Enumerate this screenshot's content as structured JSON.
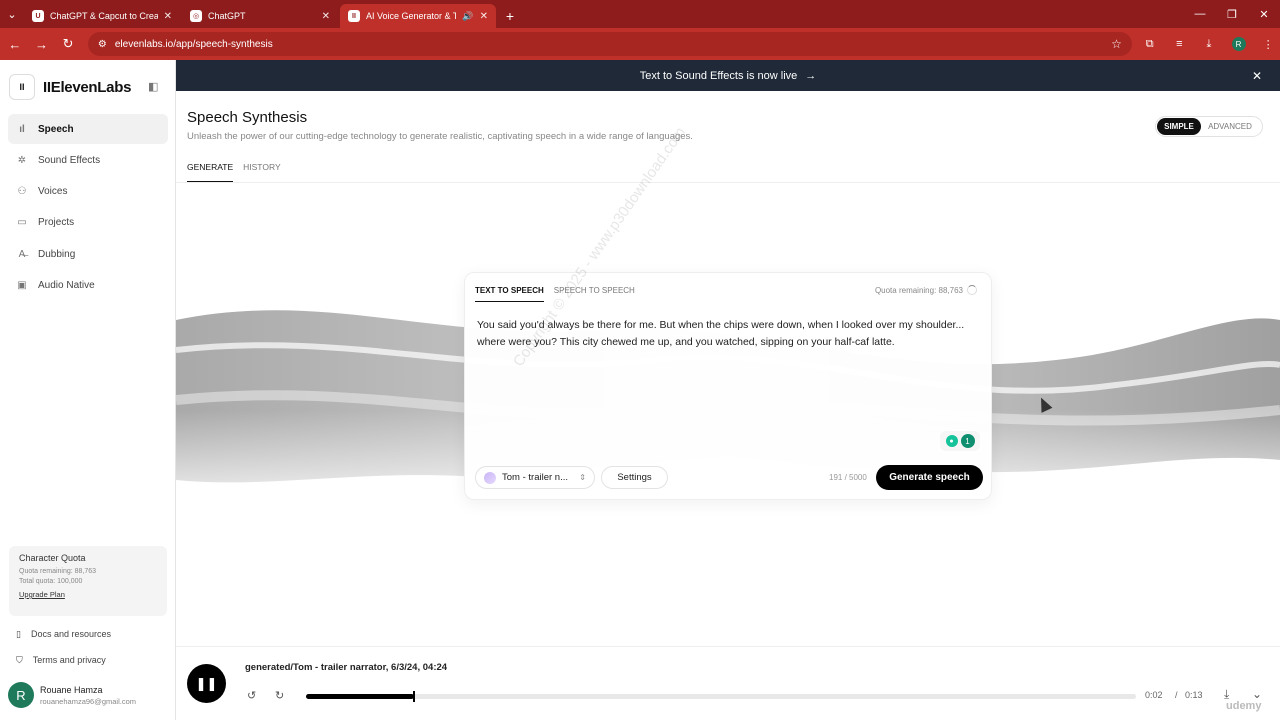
{
  "browser": {
    "tabs": [
      {
        "title": "ChatGPT & Capcut to Create ai",
        "active": false
      },
      {
        "title": "ChatGPT",
        "active": false
      },
      {
        "title": "AI Voice Generator & Text t",
        "active": true
      }
    ],
    "url": "elevenlabs.io/app/speech-synthesis",
    "profile_initial": "R"
  },
  "brand": {
    "badge": "II",
    "name": "IIElevenLabs"
  },
  "sidebar": {
    "items": [
      {
        "label": "Speech",
        "icon": "waveform-icon"
      },
      {
        "label": "Sound Effects",
        "icon": "sparkle-icon"
      },
      {
        "label": "Voices",
        "icon": "person-icon"
      },
      {
        "label": "Projects",
        "icon": "book-icon"
      },
      {
        "label": "Dubbing",
        "icon": "translate-icon"
      },
      {
        "label": "Audio Native",
        "icon": "audio-native-icon"
      }
    ],
    "quota": {
      "title": "Character Quota",
      "remaining": "Quota remaining: 88,763",
      "total": "Total quota: 100,000",
      "upgrade": "Upgrade Plan"
    },
    "docs": "Docs and resources",
    "terms": "Terms and privacy",
    "user": {
      "initial": "R",
      "name": "Rouane Hamza",
      "email": "rouanehamza96@gmail.com"
    }
  },
  "banner": {
    "text": "Text to Sound Effects is now live",
    "arrow": "→",
    "close": "✕"
  },
  "header": {
    "title": "Speech Synthesis",
    "subtitle": "Unleash the power of our cutting-edge technology to generate realistic, captivating speech in a wide range of languages.",
    "mode_simple": "SIMPLE",
    "mode_advanced": "ADVANCED",
    "tabs": [
      "GENERATE",
      "HISTORY"
    ]
  },
  "editor": {
    "tabs": [
      "TEXT TO SPEECH",
      "SPEECH TO SPEECH"
    ],
    "quota": "Quota remaining: 88,763",
    "text": "You said you'd always be there for me. But when the chips were down, when I looked over my shoulder... where were you? This city chewed me up, and you watched, sipping on your half-caf latte.",
    "voice": "Tom - trailer n...",
    "settings": "Settings",
    "char_count": "191 / 5000",
    "generate": "Generate speech",
    "grammar_badge": "1"
  },
  "watermark": "Copyright © 2025 - www.p30download.com",
  "player": {
    "title": "generated/Tom - trailer narrator, 6/3/24, 04:24",
    "current": "0:02",
    "separator": "/",
    "duration": "0:13",
    "progress": 0.13
  },
  "overlay": {
    "udemy": "udemy"
  }
}
